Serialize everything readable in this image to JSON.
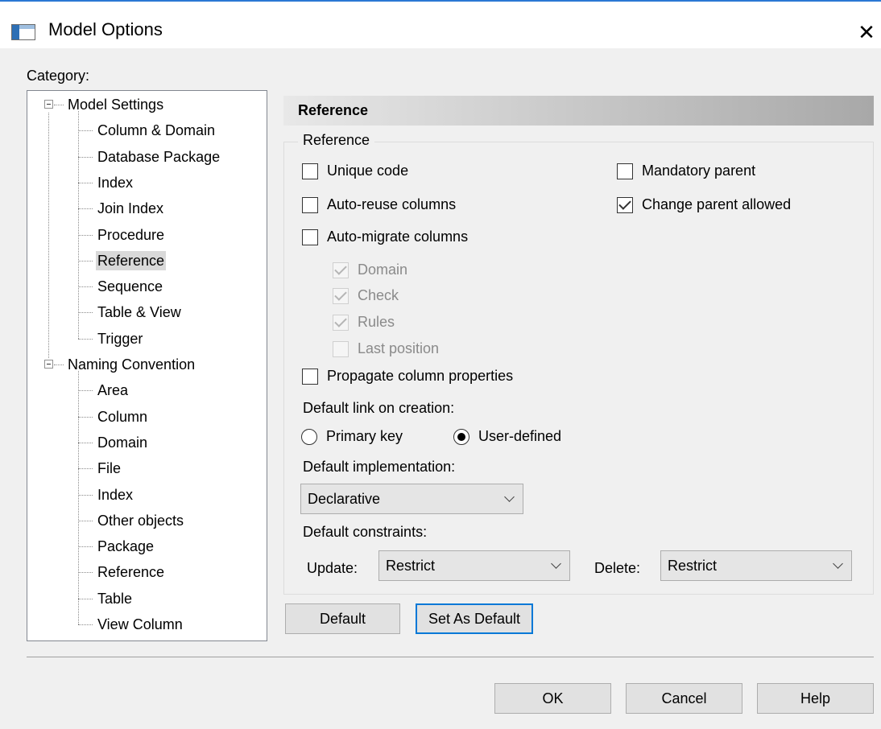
{
  "window": {
    "title": "Model Options",
    "close_symbol": "✕"
  },
  "category_label": "Category:",
  "tree": [
    {
      "label": "Model Settings",
      "level": 0,
      "expanded": true
    },
    {
      "label": "Column & Domain",
      "level": 1
    },
    {
      "label": "Database Package",
      "level": 1
    },
    {
      "label": "Index",
      "level": 1
    },
    {
      "label": "Join Index",
      "level": 1
    },
    {
      "label": "Procedure",
      "level": 1
    },
    {
      "label": "Reference",
      "level": 1,
      "selected": true
    },
    {
      "label": "Sequence",
      "level": 1
    },
    {
      "label": "Table & View",
      "level": 1
    },
    {
      "label": "Trigger",
      "level": 1
    },
    {
      "label": "Naming Convention",
      "level": 0,
      "expanded": true
    },
    {
      "label": "Area",
      "level": 1
    },
    {
      "label": "Column",
      "level": 1
    },
    {
      "label": "Domain",
      "level": 1
    },
    {
      "label": "File",
      "level": 1
    },
    {
      "label": "Index",
      "level": 1
    },
    {
      "label": "Other objects",
      "level": 1
    },
    {
      "label": "Package",
      "level": 1
    },
    {
      "label": "Reference",
      "level": 1
    },
    {
      "label": "Table",
      "level": 1
    },
    {
      "label": "View Column",
      "level": 1
    }
  ],
  "panel": {
    "header": "Reference",
    "group_title": "Reference",
    "checkboxes": {
      "unique_code": {
        "label": "Unique code",
        "checked": false
      },
      "auto_reuse": {
        "label": "Auto-reuse columns",
        "checked": false
      },
      "auto_migrate": {
        "label": "Auto-migrate columns",
        "checked": false
      },
      "domain": {
        "label": "Domain",
        "checked": true,
        "disabled": true
      },
      "check": {
        "label": "Check",
        "checked": true,
        "disabled": true
      },
      "rules": {
        "label": "Rules",
        "checked": true,
        "disabled": true
      },
      "last_position": {
        "label": "Last position",
        "checked": false,
        "disabled": true
      },
      "propagate": {
        "label": "Propagate column properties",
        "checked": false
      },
      "mandatory_parent": {
        "label": "Mandatory parent",
        "checked": false
      },
      "change_parent": {
        "label": "Change parent allowed",
        "checked": true
      }
    },
    "default_link_label": "Default link on creation:",
    "radios": {
      "primary_key": {
        "label": "Primary key",
        "selected": false
      },
      "user_defined": {
        "label": "User-defined",
        "selected": true
      }
    },
    "default_impl_label": "Default implementation:",
    "default_impl_value": "Declarative",
    "default_constraints_label": "Default constraints:",
    "update_label": "Update:",
    "update_value": "Restrict",
    "delete_label": "Delete:",
    "delete_value": "Restrict",
    "default_button": "Default",
    "set_default_button": "Set As Default"
  },
  "footer": {
    "ok": "OK",
    "cancel": "Cancel",
    "help": "Help"
  }
}
